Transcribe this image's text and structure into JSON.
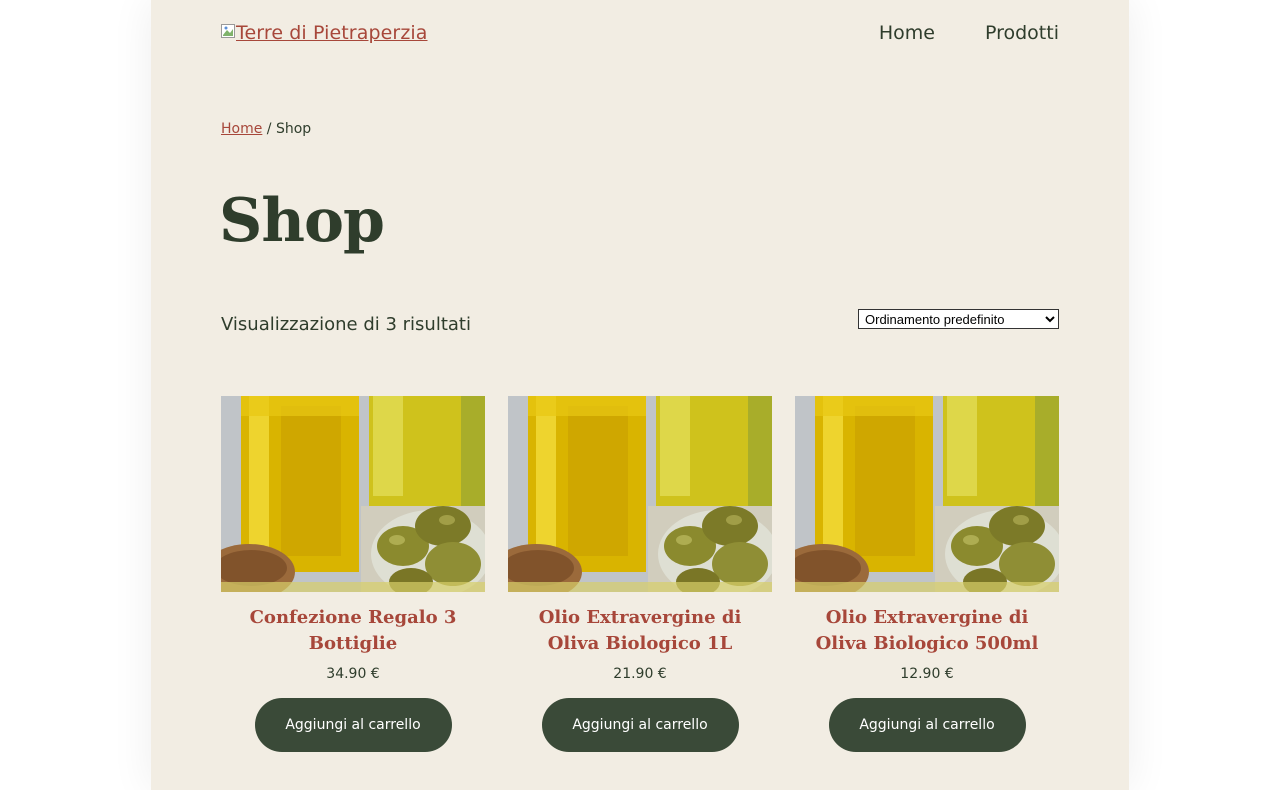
{
  "header": {
    "logo_text": "Terre di Pietraperzia",
    "nav": [
      {
        "label": "Home"
      },
      {
        "label": "Prodotti"
      }
    ]
  },
  "breadcrumb": {
    "home": "Home",
    "separator": " / ",
    "current": "Shop"
  },
  "page_title": "Shop",
  "result_count": "Visualizzazione di 3 risultati",
  "sort": {
    "selected": "Ordinamento predefinito"
  },
  "products": [
    {
      "name": "Confezione Regalo 3 Bottiglie",
      "price": "34.90 €",
      "button": "Aggiungi al carrello"
    },
    {
      "name": "Olio Extravergine di Oliva Biologico 1L",
      "price": "21.90 €",
      "button": "Aggiungi al carrello"
    },
    {
      "name": "Olio Extravergine di Oliva Biologico 500ml",
      "price": "12.90 €",
      "button": "Aggiungi al carrello"
    }
  ],
  "colors": {
    "background": "#f2ede3",
    "accent": "#a7473a",
    "dark_green": "#3a4a38",
    "text": "#2f3d2c"
  }
}
